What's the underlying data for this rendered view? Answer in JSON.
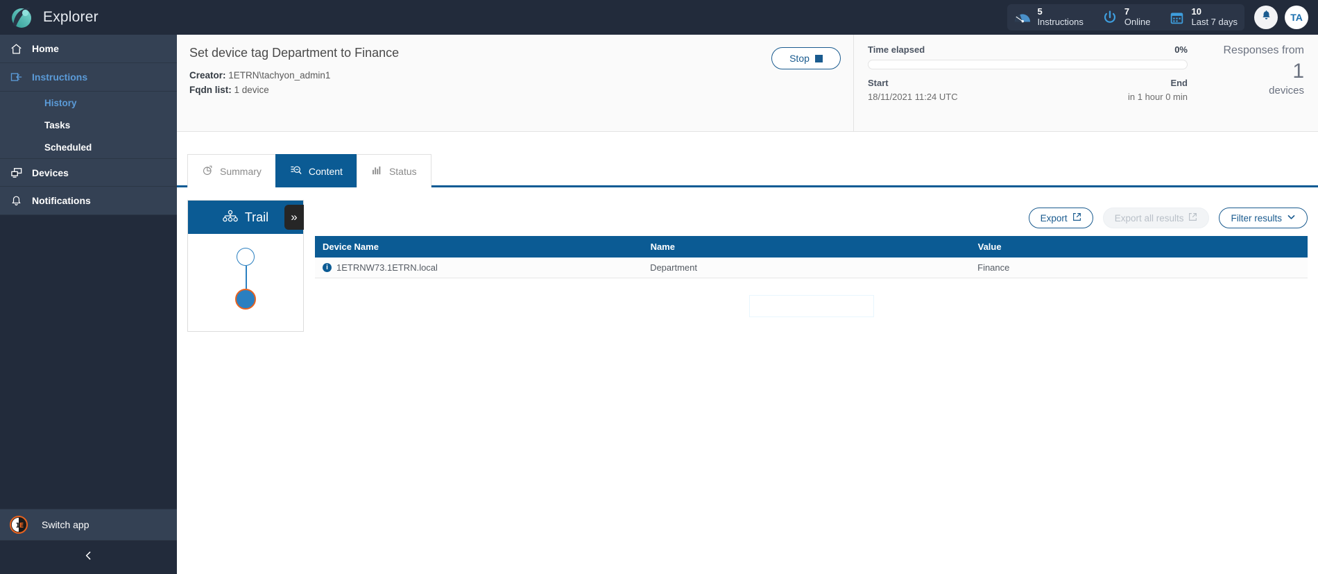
{
  "app": {
    "name": "Explorer",
    "logo_icon": "explorer-logo"
  },
  "header": {
    "stats": [
      {
        "icon": "gauge-icon",
        "number": "5",
        "label": "Instructions"
      },
      {
        "icon": "power-icon",
        "number": "7",
        "label": "Online"
      },
      {
        "icon": "calendar-icon",
        "number": "10",
        "label": "Last 7 days"
      }
    ],
    "bell_icon": "bell-icon",
    "avatar_initials": "TA"
  },
  "sidebar": {
    "items": [
      {
        "label": "Home",
        "icon": "home-icon",
        "active": false
      },
      {
        "label": "Instructions",
        "icon": "instructions-icon",
        "active": true
      },
      {
        "label": "Devices",
        "icon": "devices-icon",
        "active": false
      },
      {
        "label": "Notifications",
        "icon": "bell-icon",
        "active": false
      }
    ],
    "sub_items": [
      {
        "label": "History",
        "active": true
      },
      {
        "label": "Tasks",
        "active": false
      },
      {
        "label": "Scheduled",
        "active": false
      }
    ],
    "switch_app": {
      "label": "Switch app",
      "logo_text": "1E"
    },
    "collapse_icon": "chevron-left-icon"
  },
  "job": {
    "title": "Set device tag Department to Finance",
    "creator_label": "Creator:",
    "creator_value": "1ETRN\\tachyon_admin1",
    "fqdn_label": "Fqdn list:",
    "fqdn_value": "1 device",
    "stop_button": "Stop"
  },
  "progress": {
    "time_elapsed_label": "Time elapsed",
    "percent": "0%",
    "start_label": "Start",
    "start_value": "18/11/2021 11:24 UTC",
    "end_label": "End",
    "end_value": "in 1 hour 0 min"
  },
  "responses": {
    "title": "Responses from",
    "count": "1",
    "unit": "devices"
  },
  "tabs": [
    {
      "label": "Summary",
      "icon": "pie-chart-icon",
      "active": false
    },
    {
      "label": "Content",
      "icon": "content-search-icon",
      "active": true
    },
    {
      "label": "Status",
      "icon": "bar-chart-icon",
      "active": false
    }
  ],
  "trail": {
    "title": "Trail",
    "icon": "sitemap-icon",
    "expand_icon": "double-chevron-right-icon"
  },
  "toolbar": {
    "export_label": "Export",
    "export_all_label": "Export all results",
    "filter_label": "Filter results"
  },
  "table": {
    "columns": [
      "Device Name",
      "Name",
      "Value"
    ],
    "rows": [
      {
        "device_name": "1ETRNW73.1ETRN.local",
        "name": "Department",
        "value": "Finance"
      }
    ]
  },
  "colors": {
    "brand_dark": "#222b3b",
    "sidebar": "#344154",
    "accent_blue": "#0b5b94",
    "link_blue": "#5b9bd8",
    "orange": "#e8621f"
  }
}
